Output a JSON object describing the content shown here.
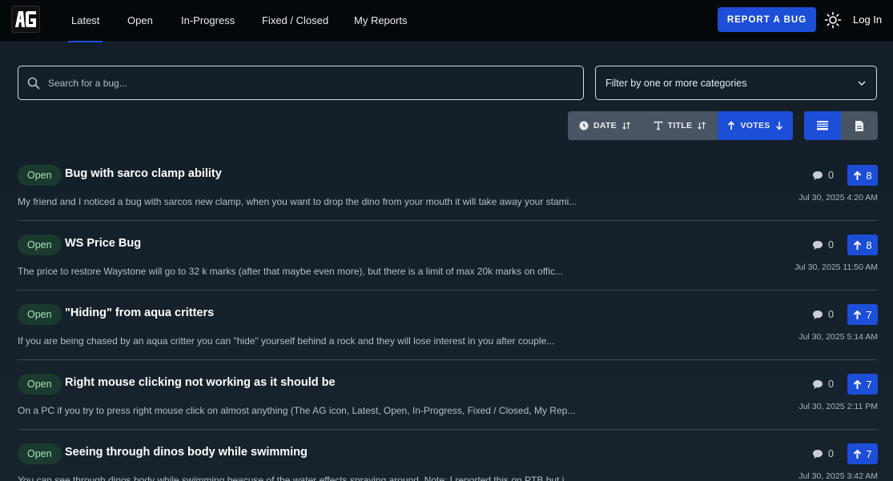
{
  "nav": {
    "logo_alt": "AG",
    "items": [
      "Latest",
      "Open",
      "In-Progress",
      "Fixed / Closed",
      "My Reports"
    ],
    "report_button": "REPORT A BUG",
    "login": "Log In"
  },
  "search": {
    "placeholder": "Search for a bug..."
  },
  "filter": {
    "label": "Filter by one or more categories"
  },
  "sort": {
    "date": "DATE",
    "title": "TITLE",
    "votes": "VOTES"
  },
  "bugs": [
    {
      "status": "Open",
      "title": "Bug with sarco clamp ability",
      "description": "My friend and I noticed a bug with sarcos new clamp, when you want to drop the dino from your mouth it will take away your stami...",
      "comments": "0",
      "votes": "8",
      "date": "Jul 30, 2025 4:20 AM"
    },
    {
      "status": "Open",
      "title": "WS Price Bug",
      "description": "The price to restore Waystone will go to 32 k marks (after that maybe even more), but there is a limit of max 20k marks on offic...",
      "comments": "0",
      "votes": "8",
      "date": "Jul 30, 2025 11:50 AM"
    },
    {
      "status": "Open",
      "title": "\"Hiding\" from aqua critters",
      "description": "If you are being chased by an aqua critter you can \"hide\" yourself behind a rock and they will lose interest in you after couple...",
      "comments": "0",
      "votes": "7",
      "date": "Jul 30, 2025 5:14 AM"
    },
    {
      "status": "Open",
      "title": "Right mouse clicking not working as it should be",
      "description": "On a PC if you try to press right mouse click on almost anything (The AG icon, Latest, Open, In-Progress, Fixed / Closed, My Rep...",
      "comments": "0",
      "votes": "7",
      "date": "Jul 30, 2025 2:11 PM"
    },
    {
      "status": "Open",
      "title": "Seeing through dinos body while swimming",
      "description": "You can see through dinos body while swimming beacuse of the water effects spraying around. Note: I reported this on PTB but i...",
      "comments": "0",
      "votes": "7",
      "date": "Jul 30, 2025 3:42 AM"
    }
  ],
  "colors": {
    "accent": "#1d4ed8",
    "badge_bg": "#1a3a2e",
    "badge_text": "#a8e0bc"
  }
}
